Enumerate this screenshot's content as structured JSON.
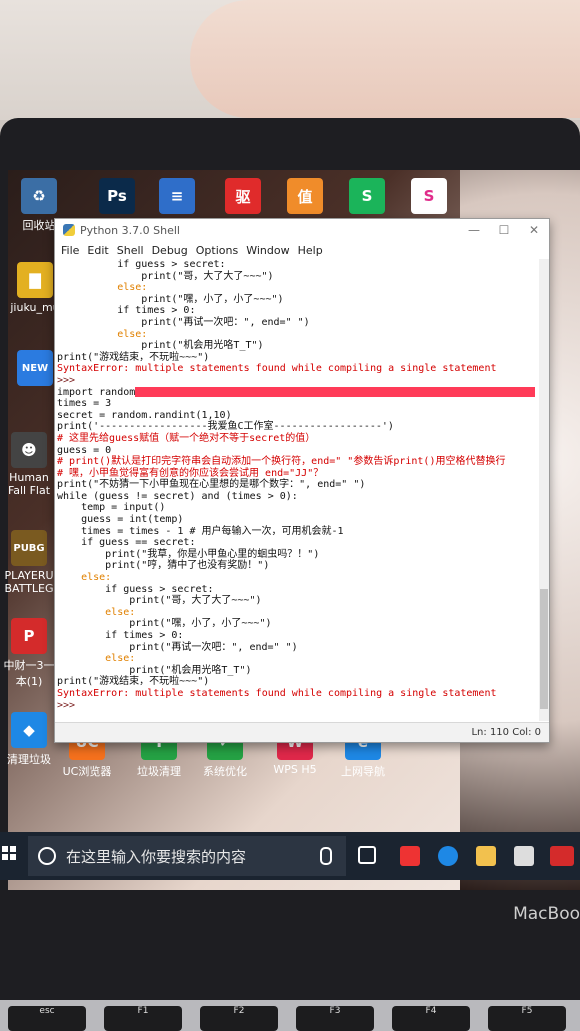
{
  "desktop_icons": [
    {
      "label": "回收站",
      "glyph": "♻",
      "color": "#3b6ea5"
    },
    {
      "label": "jiuku_mu",
      "glyph": "▇",
      "color": "#e3b021"
    },
    {
      "label": "",
      "glyph": "NEW",
      "color": "#2b7be0"
    },
    {
      "label": "Human Fall Flat",
      "glyph": "☻",
      "color": "#444"
    },
    {
      "label": "PLAYERU BATTLEG",
      "glyph": "PUBG",
      "color": "#7a5a20"
    },
    {
      "label": "中财一3一本(1)",
      "glyph": "P",
      "color": "#d42b2b"
    },
    {
      "label": "清理垃圾",
      "glyph": "◆",
      "color": "#1e88e5"
    },
    {
      "label": "UC浏览器",
      "glyph": "UC",
      "color": "#f5711d"
    },
    {
      "label": "垃圾清理",
      "glyph": "✚",
      "color": "#25a244"
    },
    {
      "label": "系统优化",
      "glyph": "✓",
      "color": "#25a244"
    },
    {
      "label": "WPS H5",
      "glyph": "W",
      "color": "#e0284a"
    },
    {
      "label": "上网导航",
      "glyph": "e",
      "color": "#1e88e5"
    }
  ],
  "top_icons": [
    {
      "glyph": "Ps",
      "color": "#0b2a4a"
    },
    {
      "glyph": "≡",
      "color": "#2f6ec9"
    },
    {
      "glyph": "驱",
      "color": "#e02b2b"
    },
    {
      "glyph": "值",
      "color": "#f08c2a"
    },
    {
      "glyph": "S",
      "color": "#1bb45a"
    },
    {
      "glyph": "S",
      "color": "#ffffff"
    }
  ],
  "window": {
    "title": "Python 3.7.0 Shell",
    "menu": [
      "File",
      "Edit",
      "Shell",
      "Debug",
      "Options",
      "Window",
      "Help"
    ],
    "status": "Ln: 110  Col: 0"
  },
  "code_lines": [
    {
      "cls": "",
      "text": "          if guess > secret:"
    },
    {
      "cls": "",
      "text": "              print(\"哥，大了大了~~~\")"
    },
    {
      "cls": "kw",
      "text": "          else:"
    },
    {
      "cls": "",
      "text": "              print(\"嘿，小了，小了~~~\")"
    },
    {
      "cls": "",
      "text": "          if times > 0:"
    },
    {
      "cls": "",
      "text": "              print(\"再试一次吧：\", end=\" \")"
    },
    {
      "cls": "kw",
      "text": "          else:"
    },
    {
      "cls": "",
      "text": "              print(\"机会用光咯T_T\")"
    },
    {
      "cls": "",
      "text": "print(\"游戏结束，不玩啦~~~\")"
    },
    {
      "cls": "err",
      "text": "SyntaxError: multiple statements found while compiling a single statement"
    },
    {
      "cls": "prompt",
      "text": ">>> "
    },
    {
      "cls": "sel",
      "text": "import random"
    },
    {
      "cls": "",
      "text": "times = 3"
    },
    {
      "cls": "",
      "text": "secret = random.randint(1,10)"
    },
    {
      "cls": "",
      "text": "print('------------------我爱鱼C工作室------------------')"
    },
    {
      "cls": "cmt",
      "text": "# 这里先给guess赋值（赋一个绝对不等于secret的值）"
    },
    {
      "cls": "",
      "text": "guess = 0"
    },
    {
      "cls": "cmt",
      "text": "# print()默认是打印完字符串会自动添加一个换行符，end=\" \"参数告诉print()用空格代替换行"
    },
    {
      "cls": "cmt",
      "text": "# 嘿，小甲鱼觉得富有创意的你应该会尝试用 end=\"JJ\"？"
    },
    {
      "cls": "",
      "text": "print(\"不妨猜一下小甲鱼现在心里想的是哪个数字：\", end=\" \")"
    },
    {
      "cls": "",
      "text": "while (guess != secret) and (times > 0):"
    },
    {
      "cls": "",
      "text": "    temp = input()"
    },
    {
      "cls": "",
      "text": "    guess = int(temp)"
    },
    {
      "cls": "",
      "text": "    times = times - 1 # 用户每输入一次，可用机会就-1"
    },
    {
      "cls": "",
      "text": "    if guess == secret:"
    },
    {
      "cls": "",
      "text": "        print(\"我草，你是小甲鱼心里的蛔虫吗？！\")"
    },
    {
      "cls": "",
      "text": "        print(\"哼，猜中了也没有奖励！\")"
    },
    {
      "cls": "kw",
      "text": "    else:"
    },
    {
      "cls": "",
      "text": "        if guess > secret:"
    },
    {
      "cls": "",
      "text": "            print(\"哥，大了大了~~~\")"
    },
    {
      "cls": "kw",
      "text": "        else:"
    },
    {
      "cls": "",
      "text": "            print(\"嘿，小了，小了~~~\")"
    },
    {
      "cls": "",
      "text": "        if times > 0:"
    },
    {
      "cls": "",
      "text": "            print(\"再试一次吧：\", end=\" \")"
    },
    {
      "cls": "kw",
      "text": "        else:"
    },
    {
      "cls": "",
      "text": "            print(\"机会用光咯T_T\")"
    },
    {
      "cls": "",
      "text": "print(\"游戏结束，不玩啦~~~\")"
    },
    {
      "cls": "err",
      "text": "SyntaxError: multiple statements found while compiling a single statement"
    },
    {
      "cls": "prompt",
      "text": ">>> "
    }
  ],
  "taskbar": {
    "search_placeholder": "在这里输入你要搜索的内容"
  },
  "laptop": {
    "brand": "MacBoo",
    "keys": [
      "esc",
      "F1",
      "F2",
      "F3",
      "F4",
      "F5"
    ]
  }
}
